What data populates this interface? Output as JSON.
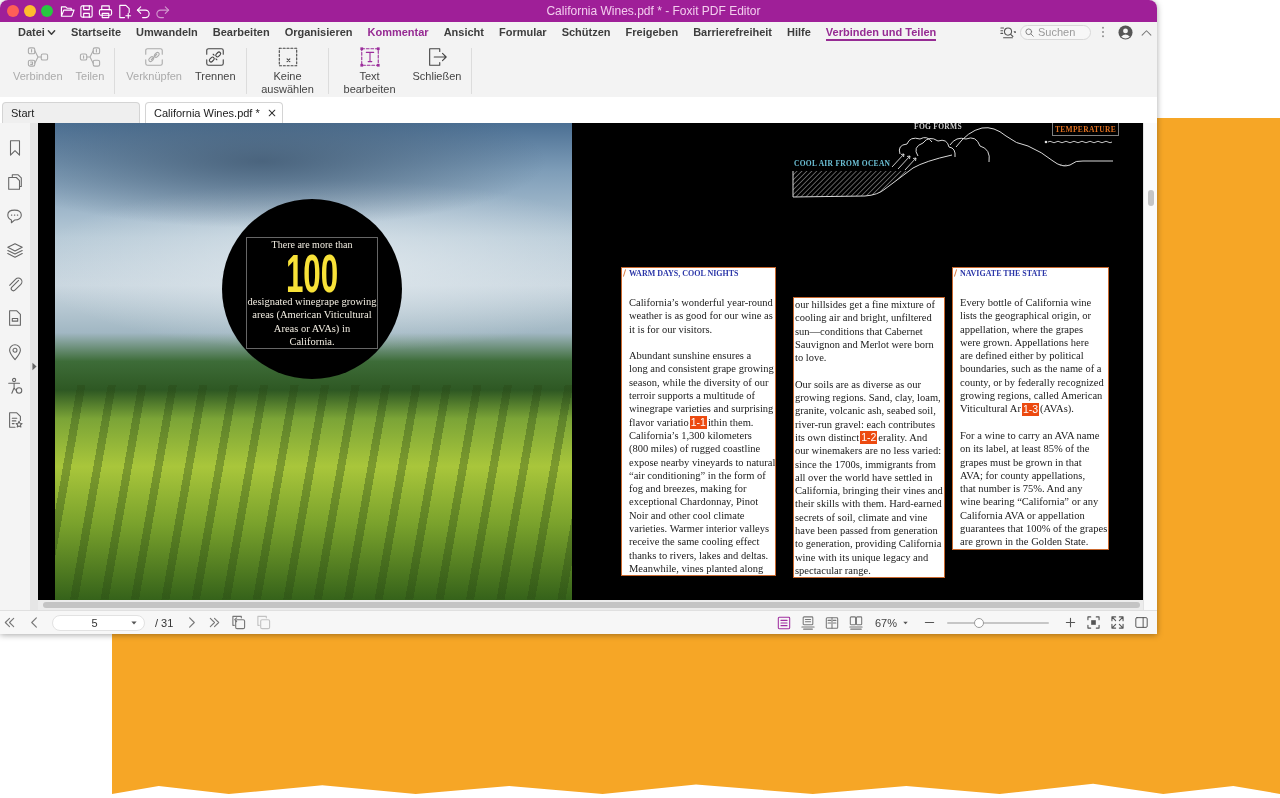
{
  "window": {
    "title": "California Wines.pdf * - Foxit PDF Editor"
  },
  "title_toolbar": [
    {
      "disabled": false
    },
    {
      "disabled": false
    },
    {
      "disabled": false
    },
    {
      "disabled": false
    },
    {
      "disabled": false
    },
    {
      "disabled": true
    }
  ],
  "menu": [
    {
      "label": "Datei",
      "dropdown": true,
      "selected": false,
      "highlighted": false
    },
    {
      "label": "Startseite",
      "dropdown": false,
      "selected": false,
      "highlighted": false
    },
    {
      "label": "Umwandeln",
      "dropdown": false,
      "selected": false,
      "highlighted": false
    },
    {
      "label": "Bearbeiten",
      "dropdown": false,
      "selected": false,
      "highlighted": false
    },
    {
      "label": "Organisieren",
      "dropdown": false,
      "selected": false,
      "highlighted": false
    },
    {
      "label": "Kommentar",
      "dropdown": false,
      "selected": false,
      "highlighted": true
    },
    {
      "label": "Ansicht",
      "dropdown": false,
      "selected": false,
      "highlighted": false
    },
    {
      "label": "Formular",
      "dropdown": false,
      "selected": false,
      "highlighted": false
    },
    {
      "label": "Schützen",
      "dropdown": false,
      "selected": false,
      "highlighted": false
    },
    {
      "label": "Freigeben",
      "dropdown": false,
      "selected": false,
      "highlighted": false
    },
    {
      "label": "Barrierefreiheit",
      "dropdown": false,
      "selected": false,
      "highlighted": false
    },
    {
      "label": "Hilfe",
      "dropdown": false,
      "selected": false,
      "highlighted": false
    },
    {
      "label": "Verbinden und Teilen",
      "dropdown": false,
      "selected": true,
      "highlighted": false
    }
  ],
  "search": {
    "placeholder": "Suchen"
  },
  "ribbon": {
    "groups": [
      {
        "buttons": [
          {
            "label": "Verbinden",
            "disabled": true
          },
          {
            "label": "Teilen",
            "disabled": true
          }
        ]
      },
      {
        "buttons": [
          {
            "label": "Verknüpfen",
            "disabled": true
          },
          {
            "label": "Trennen",
            "disabled": false
          }
        ]
      },
      {
        "buttons": [
          {
            "label": "Keine auswählen",
            "disabled": false
          }
        ]
      },
      {
        "buttons": [
          {
            "label": "Text bearbeiten",
            "disabled": false
          },
          {
            "label": "Schließen",
            "disabled": false
          }
        ]
      }
    ]
  },
  "tabs": [
    {
      "label": "Start",
      "selected": false,
      "closable": false
    },
    {
      "label": "California Wines.pdf *",
      "selected": true,
      "closable": true
    }
  ],
  "document": {
    "callout": {
      "intro": "There are more than",
      "number": "100",
      "text": "designated winegrape growing\nareas (American Viticultural\nAreas or AVAs) in\nCalifornia."
    },
    "diagram": {
      "fog_label": "FOG FORMS",
      "ocean_label": "COOL AIR FROM OCEAN",
      "temperature_label": "TEMPERATURE"
    },
    "columns": [
      {
        "heading": "WARM DAYS, COOL NIGHTS",
        "blocks": [
          {
            "kind": "paragraph",
            "text": "California’s wonderful year-round\nweather is as good for our wine as\nit is for our visitors."
          },
          {
            "kind": "paragraph",
            "text": "Abundant sunshine ensures a\nlong and consistent grape growing\nseason, while the diversity of our\nterroir supports a multitude of\nwinegrape varieties and surprising"
          },
          {
            "kind": "marked-line",
            "before": "flavor variatio",
            "marker": "1-1",
            "after": "ithin them."
          },
          {
            "kind": "continuation",
            "text": "California’s 1,300 kilometers\n(800 miles) of rugged coastline\nexpose nearby vineyards to natural\n“air conditioning” in the form of\nfog and breezes, making for\nexceptional Chardonnay, Pinot\nNoir and other cool climate\nvarieties. Warmer interior valleys\nreceive the same cooling effect\nthanks to rivers, lakes and deltas.\nMeanwhile, vines planted along"
          }
        ]
      },
      {
        "blocks": [
          {
            "kind": "paragraph",
            "text": "our hillsides get a fine mixture of\ncooling air and bright, unfiltered\nsun—conditions that Cabernet\nSauvignon and Merlot were born\nto love."
          },
          {
            "kind": "paragraph",
            "text": "Our soils are as diverse as our\ngrowing regions. Sand, clay, loam,\ngranite, volcanic ash, seabed soil,\nriver-run gravel: each contributes"
          },
          {
            "kind": "marked-line",
            "before": "its own distinct",
            "marker": "1-2",
            "after": "erality. And"
          },
          {
            "kind": "continuation",
            "text": "our winemakers are no less varied:\nsince the 1700s, immigrants from\nall over the world have settled in\nCalifornia, bringing their vines and\ntheir skills with them. Hard-earned\nsecrets of soil, climate and vine\nhave been passed from generation\nto generation, providing California\nwine with its unique legacy and\nspectacular range."
          }
        ]
      },
      {
        "heading": "NAVIGATE THE STATE",
        "blocks": [
          {
            "kind": "paragraph",
            "text": "Every bottle of California wine\nlists the geographical origin, or\nappellation, where the grapes\nwere grown. Appellations here\nare defined either by political\nboundaries, such as the name of a\ncounty, or by federally recognized\ngrowing regions, called American"
          },
          {
            "kind": "marked-line",
            "before": "Viticultural Ar",
            "marker": "1-3",
            "after": "(AVAs)."
          },
          {
            "kind": "paragraph",
            "text": "For a wine to carry an AVA name\non its label, at least 85% of the\ngrapes must be grown in that\nAVA; for county appellations,\nthat number is 75%. And any\nwine bearing “California” or any\nCalifornia AVA or appellation\nguarantees that 100% of the grapes\nare grown in the Golden State."
          }
        ]
      }
    ]
  },
  "status_bar": {
    "page": "5",
    "total": "/ 31",
    "page_tools": [
      {
        "disabled": false
      },
      {
        "disabled": true
      }
    ],
    "views": [
      {
        "selected": true
      },
      {
        "selected": false
      },
      {
        "selected": false
      },
      {
        "selected": false
      }
    ],
    "zoom": "67%",
    "zoom_slider": {
      "level": 0.31
    }
  }
}
